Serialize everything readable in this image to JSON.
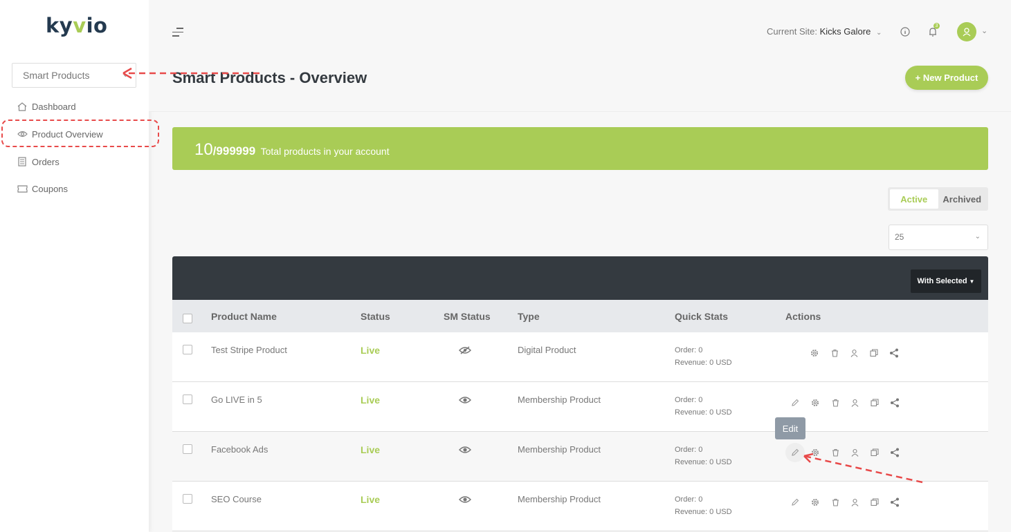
{
  "brand": {
    "logo_prefix": "ky",
    "logo_accent": "v",
    "logo_suffix": "io",
    "accent_color": "#a9cc56"
  },
  "sidebar": {
    "site_select": "Smart Products",
    "items": [
      {
        "label": "Dashboard",
        "icon": "home-icon"
      },
      {
        "label": "Product Overview",
        "icon": "eye-icon"
      },
      {
        "label": "Orders",
        "icon": "document-icon"
      },
      {
        "label": "Coupons",
        "icon": "ticket-icon"
      }
    ]
  },
  "header": {
    "current_site_label": "Current Site:",
    "current_site_value": "Kicks Galore",
    "notification_count": "3"
  },
  "page": {
    "title": "Smart Products - Overview",
    "new_button": "+ New Product"
  },
  "banner": {
    "count": "10",
    "max": "/999999",
    "text": "Total products in your account"
  },
  "filter": {
    "active": "Active",
    "archived": "Archived",
    "per_page": "25"
  },
  "table": {
    "with_selected": "With Selected",
    "headers": [
      "Product Name",
      "Status",
      "SM Status",
      "Type",
      "Quick Stats",
      "Actions"
    ],
    "rows": [
      {
        "name": "Test Stripe Product",
        "status": "Live",
        "type": "Digital Product",
        "order": "Order: 0",
        "revenue": "Revenue: 0 USD"
      },
      {
        "name": "Go LIVE in 5",
        "status": "Live",
        "type": "Membership Product",
        "order": "Order: 0",
        "revenue": "Revenue: 0 USD"
      },
      {
        "name": "Facebook Ads",
        "status": "Live",
        "type": "Membership Product",
        "order": "Order: 0",
        "revenue": "Revenue: 0 USD"
      },
      {
        "name": "SEO Course",
        "status": "Live",
        "type": "Membership Product",
        "order": "Order: 0",
        "revenue": "Revenue: 0 USD"
      }
    ],
    "tooltip": "Edit"
  }
}
